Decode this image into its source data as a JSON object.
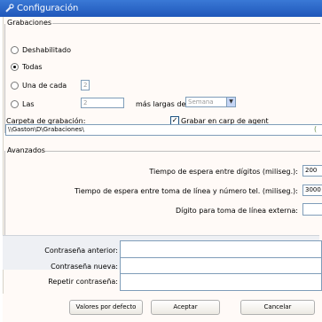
{
  "window": {
    "title": "Configuración"
  },
  "grabaciones": {
    "legend": "Grabaciones",
    "options": [
      {
        "label": "Deshabilitado",
        "selected": false
      },
      {
        "label": "Todas",
        "selected": true
      },
      {
        "label": "Una de cada",
        "selected": false,
        "value": "2"
      },
      {
        "label": "Las",
        "selected": false,
        "value": "2"
      }
    ],
    "mas_largas_label": "más largas del",
    "period_select": "Semana",
    "carpeta_label": "Carpeta de grabación:",
    "carpeta_value": "\\\\Gaston\\D\\Grabaciones\\",
    "grabar_carpeta_label": "Grabar en carp de agent",
    "grabar_carpeta_checked": true
  },
  "avanzados": {
    "legend": "Avanzados",
    "fields": [
      {
        "label": "Tiempo de espera entre dígitos (miliseg.):",
        "value": "200"
      },
      {
        "label": "Tiempo de espera entre toma de línea y número tel. (miliseg.):",
        "value": "3000"
      },
      {
        "label": "Dígito para toma de línea externa:",
        "value": ""
      }
    ]
  },
  "password": {
    "anterior_label": "Contraseña anterior:",
    "nueva_label": "Contraseña nueva:",
    "repetir_label": "Repetir contraseña:"
  },
  "buttons": {
    "defaults": "Valores por defecto",
    "accept": "Aceptar",
    "cancel": "Cancelar"
  }
}
